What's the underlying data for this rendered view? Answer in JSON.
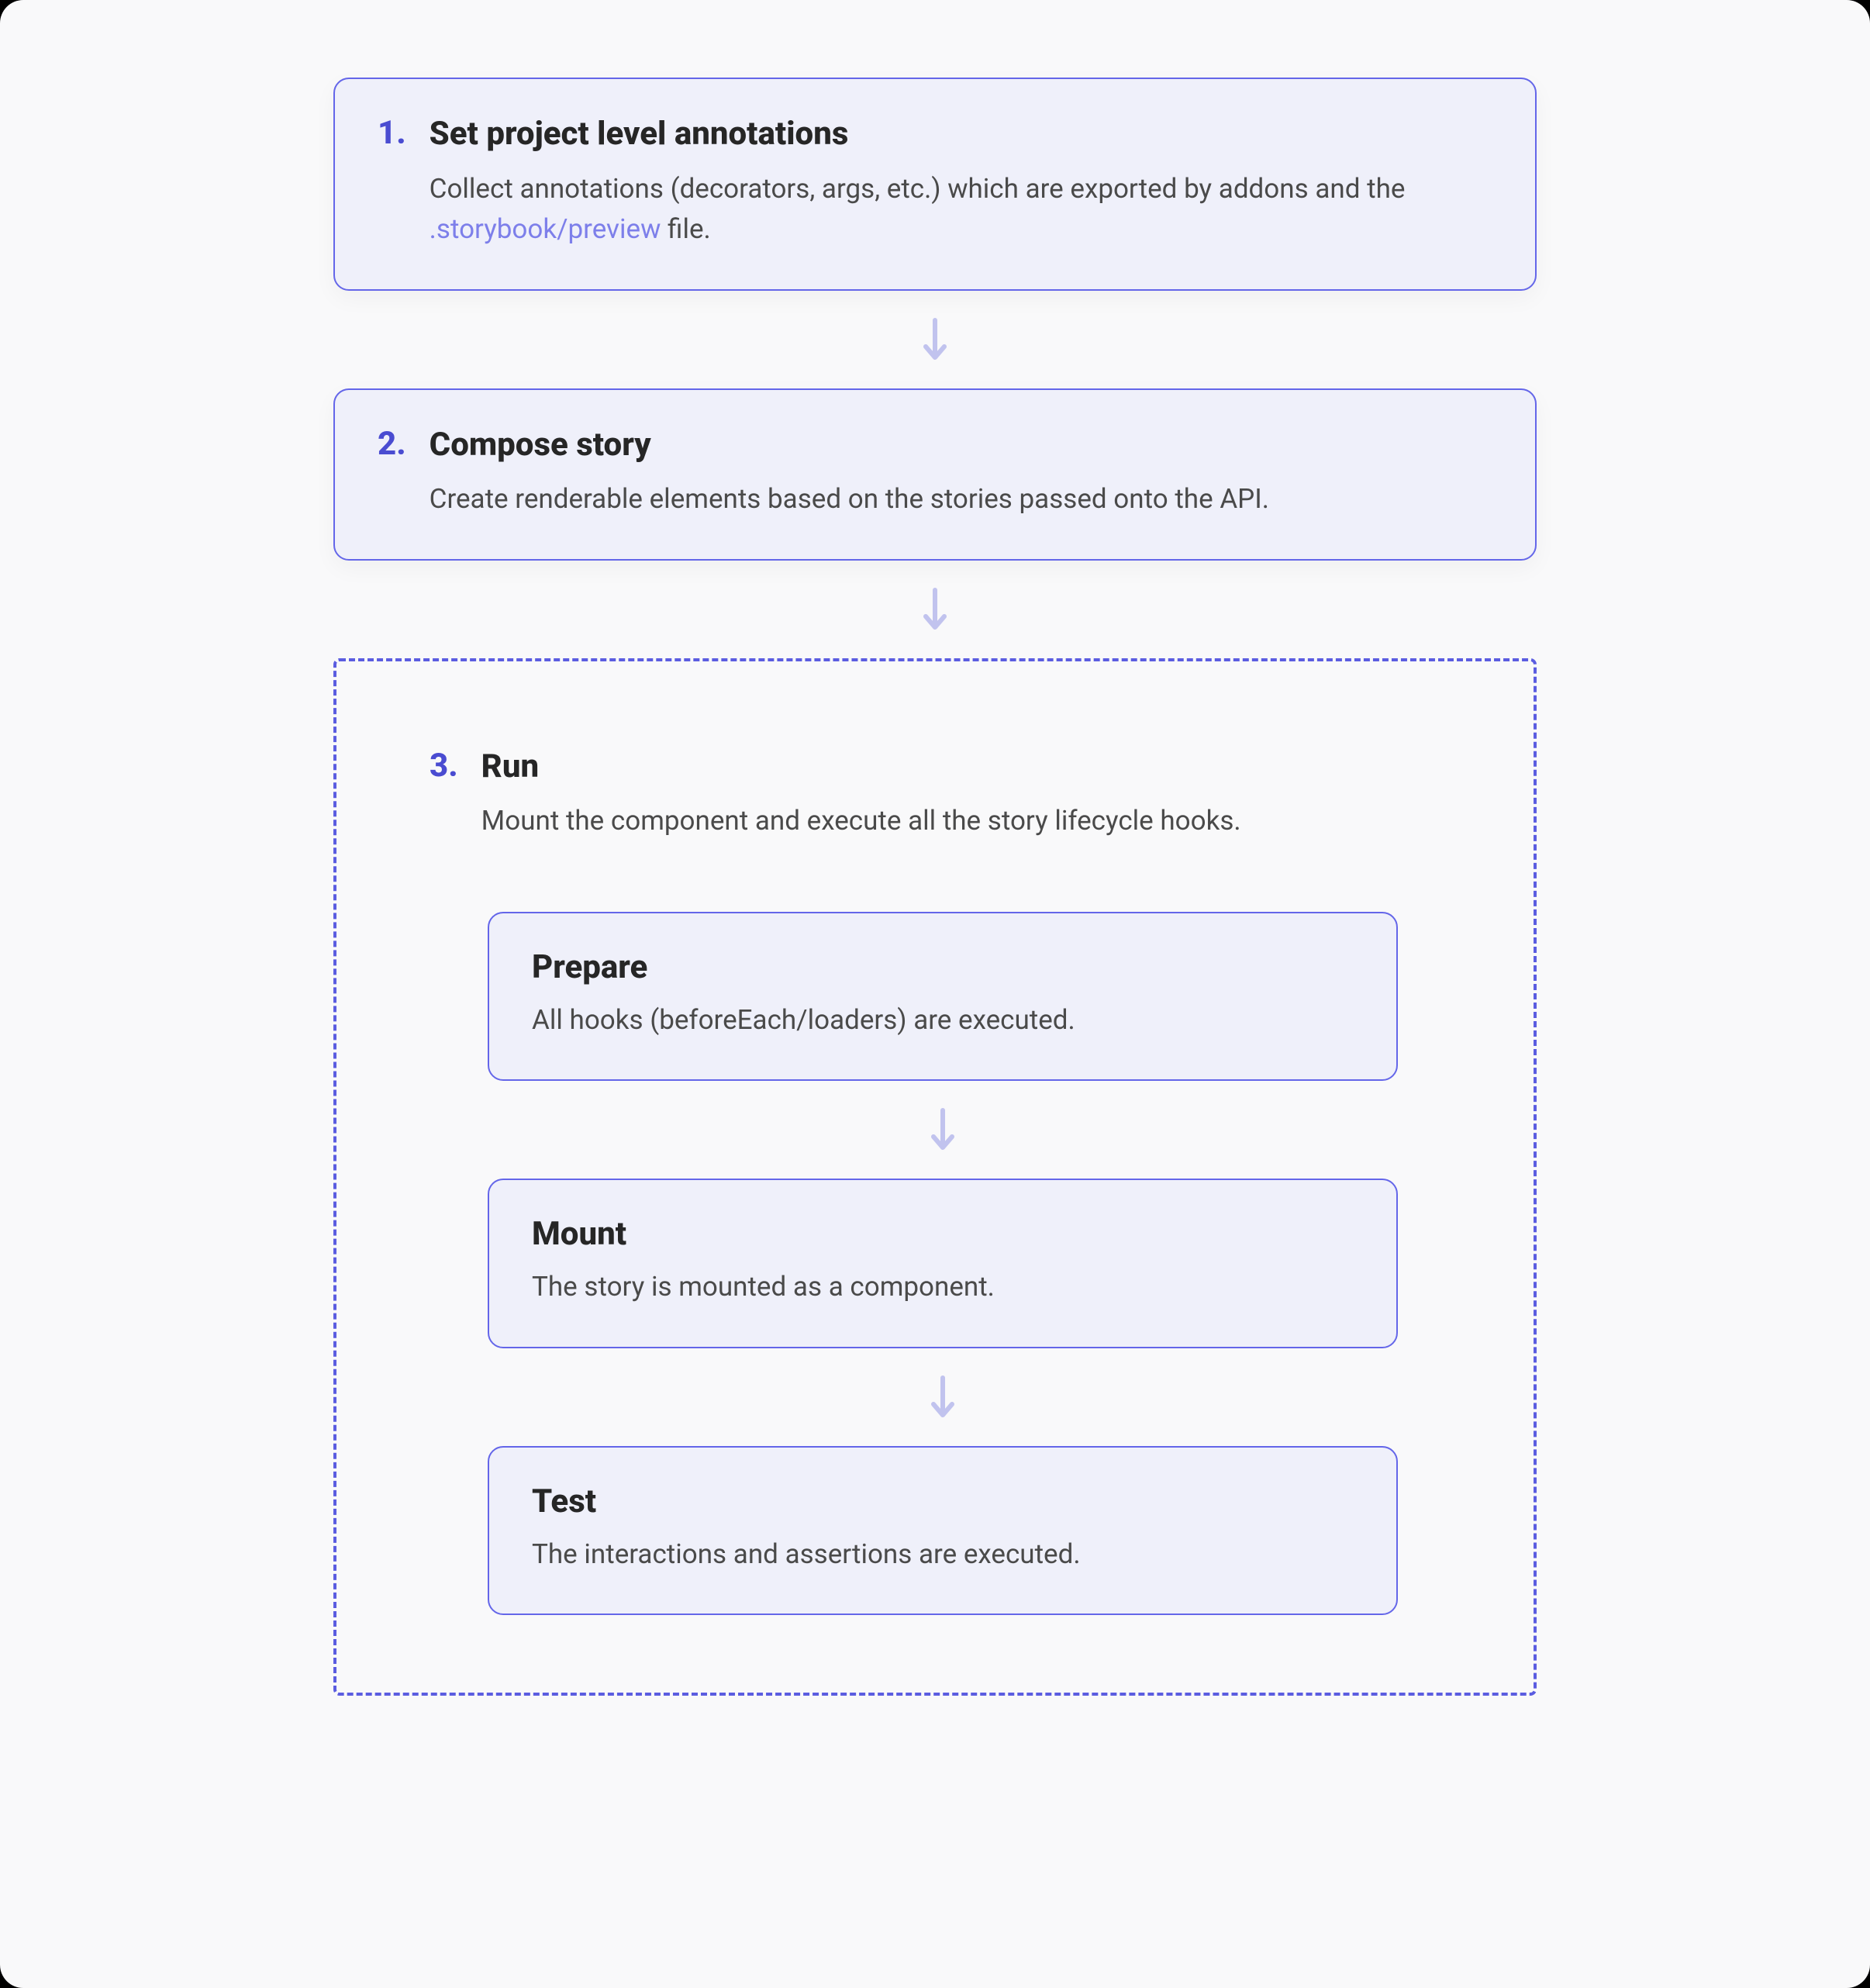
{
  "steps": [
    {
      "number": "1.",
      "title": "Set project level annotations",
      "desc_pre": " Collect annotations (decorators, args, etc.) which are exported by addons and the ",
      "desc_link": ".storybook/preview",
      "desc_post": " file."
    },
    {
      "number": "2.",
      "title": "Compose story",
      "desc": "Create renderable elements based on the stories passed onto the API."
    },
    {
      "number": "3.",
      "title": "Run",
      "desc": "Mount the component and execute all the story lifecycle hooks."
    }
  ],
  "substeps": [
    {
      "title": "Prepare",
      "desc": "All hooks (beforeEach/loaders) are executed."
    },
    {
      "title": "Mount",
      "desc": "The story is mounted as a component."
    },
    {
      "title": "Test",
      "desc": "The interactions and assertions are executed."
    }
  ]
}
